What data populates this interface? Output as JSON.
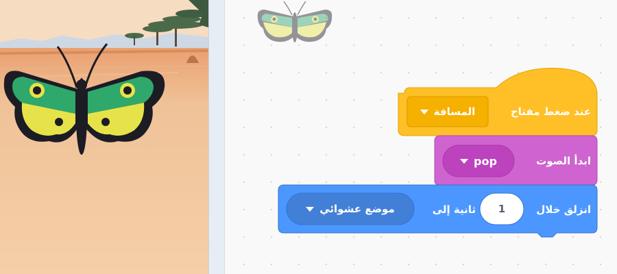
{
  "sprite": {
    "name_icon": "butterfly-icon",
    "colors": {
      "green": "#2fa86c",
      "yellow": "#e6e34a",
      "body": "#1c1c24"
    }
  },
  "stage": {
    "backdrop": "savanna",
    "colors": {
      "ground": "#f0c79c",
      "sky": "#f5d7b8",
      "mountain": "#c8d6e6",
      "tree": "#4a6a48"
    }
  },
  "blocks": {
    "hat": {
      "label": "عند ضغط مفتاح",
      "key_value": "المسافة",
      "color": "#ffbf26",
      "border": "#e0a600"
    },
    "sound": {
      "label": "ابدأ الصوت",
      "sound_value": "pop",
      "color": "#cf63cf",
      "border": "#b54ab5"
    },
    "glide": {
      "label_start": "انزلق خلال",
      "seconds": "1",
      "label_mid": "ثانية إلى",
      "target_value": "موضع عشوائي",
      "color": "#4c97ff",
      "border": "#3373cc"
    }
  }
}
